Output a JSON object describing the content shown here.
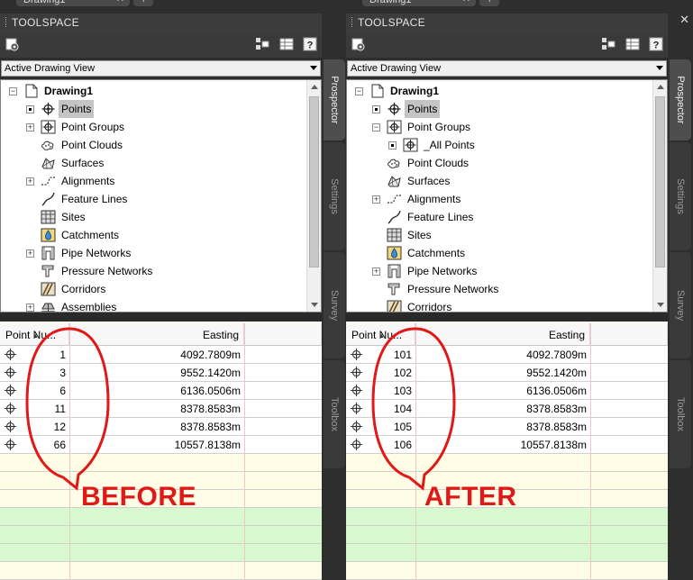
{
  "panels": [
    {
      "doc_tab": "Drawing1",
      "title": "TOOLSPACE",
      "view_dropdown": "Active Drawing View",
      "tree": [
        {
          "label": "Drawing1",
          "level": 0,
          "expander": "minus",
          "icon": "drawing-icon",
          "bold": true
        },
        {
          "label": "Points",
          "level": 1,
          "expander": "dot",
          "icon": "point-icon",
          "selected": true
        },
        {
          "label": "Point Groups",
          "level": 1,
          "expander": "plus",
          "icon": "point-group-icon"
        },
        {
          "label": "Point Clouds",
          "level": 1,
          "expander": "none",
          "icon": "point-cloud-icon"
        },
        {
          "label": "Surfaces",
          "level": 1,
          "expander": "none",
          "icon": "surface-icon"
        },
        {
          "label": "Alignments",
          "level": 1,
          "expander": "plus",
          "icon": "alignment-icon"
        },
        {
          "label": "Feature Lines",
          "level": 1,
          "expander": "none",
          "icon": "feature-line-icon"
        },
        {
          "label": "Sites",
          "level": 1,
          "expander": "none",
          "icon": "site-icon"
        },
        {
          "label": "Catchments",
          "level": 1,
          "expander": "none",
          "icon": "catchment-icon"
        },
        {
          "label": "Pipe Networks",
          "level": 1,
          "expander": "plus",
          "icon": "pipe-network-icon"
        },
        {
          "label": "Pressure Networks",
          "level": 1,
          "expander": "none",
          "icon": "pressure-network-icon"
        },
        {
          "label": "Corridors",
          "level": 1,
          "expander": "none",
          "icon": "corridor-icon"
        },
        {
          "label": "Assemblies",
          "level": 1,
          "expander": "plus",
          "icon": "assembly-icon"
        }
      ],
      "columns": [
        "Point Nu...",
        "Easting"
      ],
      "rows": [
        {
          "number": "1",
          "easting": "4092.7809m"
        },
        {
          "number": "3",
          "easting": "9552.1420m"
        },
        {
          "number": "6",
          "easting": "6136.0506m"
        },
        {
          "number": "11",
          "easting": "8378.8583m"
        },
        {
          "number": "12",
          "easting": "8378.8583m"
        },
        {
          "number": "66",
          "easting": "10557.8138m"
        }
      ],
      "annotation": "BEFORE",
      "side_tabs": [
        "Prospector",
        "Settings",
        "Survey",
        "Toolbox"
      ]
    },
    {
      "doc_tab": "Drawing1",
      "title": "TOOLSPACE",
      "view_dropdown": "Active Drawing View",
      "tree": [
        {
          "label": "Drawing1",
          "level": 0,
          "expander": "minus",
          "icon": "drawing-icon",
          "bold": true
        },
        {
          "label": "Points",
          "level": 1,
          "expander": "dot",
          "icon": "point-icon",
          "selected": true
        },
        {
          "label": "Point Groups",
          "level": 1,
          "expander": "minus",
          "icon": "point-group-icon"
        },
        {
          "label": "_All Points",
          "level": 2,
          "expander": "dot",
          "icon": "point-group-icon"
        },
        {
          "label": "Point Clouds",
          "level": 1,
          "expander": "none",
          "icon": "point-cloud-icon"
        },
        {
          "label": "Surfaces",
          "level": 1,
          "expander": "none",
          "icon": "surface-icon"
        },
        {
          "label": "Alignments",
          "level": 1,
          "expander": "plus",
          "icon": "alignment-icon"
        },
        {
          "label": "Feature Lines",
          "level": 1,
          "expander": "none",
          "icon": "feature-line-icon"
        },
        {
          "label": "Sites",
          "level": 1,
          "expander": "none",
          "icon": "site-icon"
        },
        {
          "label": "Catchments",
          "level": 1,
          "expander": "none",
          "icon": "catchment-icon"
        },
        {
          "label": "Pipe Networks",
          "level": 1,
          "expander": "plus",
          "icon": "pipe-network-icon"
        },
        {
          "label": "Pressure Networks",
          "level": 1,
          "expander": "none",
          "icon": "pressure-network-icon"
        },
        {
          "label": "Corridors",
          "level": 1,
          "expander": "none",
          "icon": "corridor-icon"
        }
      ],
      "columns": [
        "Point Nu...",
        "Easting"
      ],
      "rows": [
        {
          "number": "101",
          "easting": "4092.7809m"
        },
        {
          "number": "102",
          "easting": "9552.1420m"
        },
        {
          "number": "103",
          "easting": "6136.0506m"
        },
        {
          "number": "104",
          "easting": "8378.8583m"
        },
        {
          "number": "105",
          "easting": "8378.8583m"
        },
        {
          "number": "106",
          "easting": "10557.8138m"
        }
      ],
      "annotation": "AFTER",
      "side_tabs": [
        "Prospector",
        "Settings",
        "Survey",
        "Toolbox"
      ]
    }
  ],
  "colors": {
    "annotation_red": "#e01818",
    "grid_green": "#d8f8d0",
    "grid_yellow": "#fffde6",
    "selection": "#c4c4c4"
  }
}
